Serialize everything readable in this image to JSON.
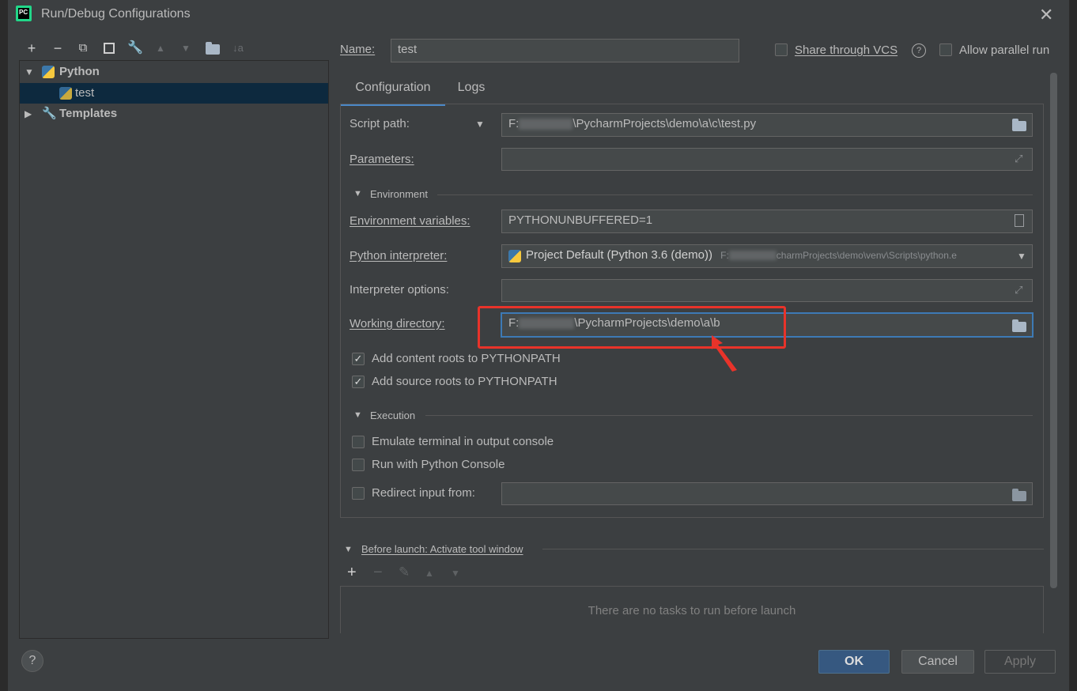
{
  "window": {
    "title": "Run/Debug Configurations",
    "app_icon_text": "PC"
  },
  "toolbar": {
    "add": "+",
    "remove": "−",
    "copy": "⧉",
    "save": "💾",
    "edit": "🔧",
    "up": "▲",
    "down": "▼",
    "folder": "📁",
    "sort": "↓a"
  },
  "tree": {
    "python_label": "Python",
    "test_label": "test",
    "templates_label": "Templates"
  },
  "name": {
    "label": "Name:",
    "value": "test"
  },
  "options": {
    "share_vcs": "Share through VCS",
    "allow_parallel": "Allow parallel run"
  },
  "tabs": {
    "configuration": "Configuration",
    "logs": "Logs"
  },
  "form": {
    "script_path_label": "Script path:",
    "script_path_prefix": "F:",
    "script_path_value": "\\PycharmProjects\\demo\\a\\c\\test.py",
    "parameters_label": "Parameters:",
    "environment_section": "Environment",
    "env_vars_label": "Environment variables:",
    "env_vars_value": "PYTHONUNBUFFERED=1",
    "interpreter_label": "Python interpreter:",
    "interpreter_value": "Project Default (Python 3.6 (demo))",
    "interpreter_path_prefix": "F:",
    "interpreter_path": "charmProjects\\demo\\venv\\Scripts\\python.e",
    "interpreter_options_label": "Interpreter options:",
    "working_dir_label": "Working directory:",
    "working_dir_prefix": "F:",
    "working_dir_value": "\\PycharmProjects\\demo\\a\\b",
    "add_content_roots": "Add content roots to PYTHONPATH",
    "add_source_roots": "Add source roots to PYTHONPATH",
    "execution_section": "Execution",
    "emulate_terminal": "Emulate terminal in output console",
    "run_python_console": "Run with Python Console",
    "redirect_input": "Redirect input from:"
  },
  "before_launch": {
    "title": "Before launch: Activate tool window",
    "add": "+",
    "remove": "−",
    "edit": "✎",
    "up": "▲",
    "down": "▼",
    "empty_text": "There are no tasks to run before launch"
  },
  "buttons": {
    "help": "?",
    "ok": "OK",
    "cancel": "Cancel",
    "apply": "Apply"
  },
  "colors": {
    "accent": "#4a88c7",
    "highlight": "#e8332a"
  }
}
